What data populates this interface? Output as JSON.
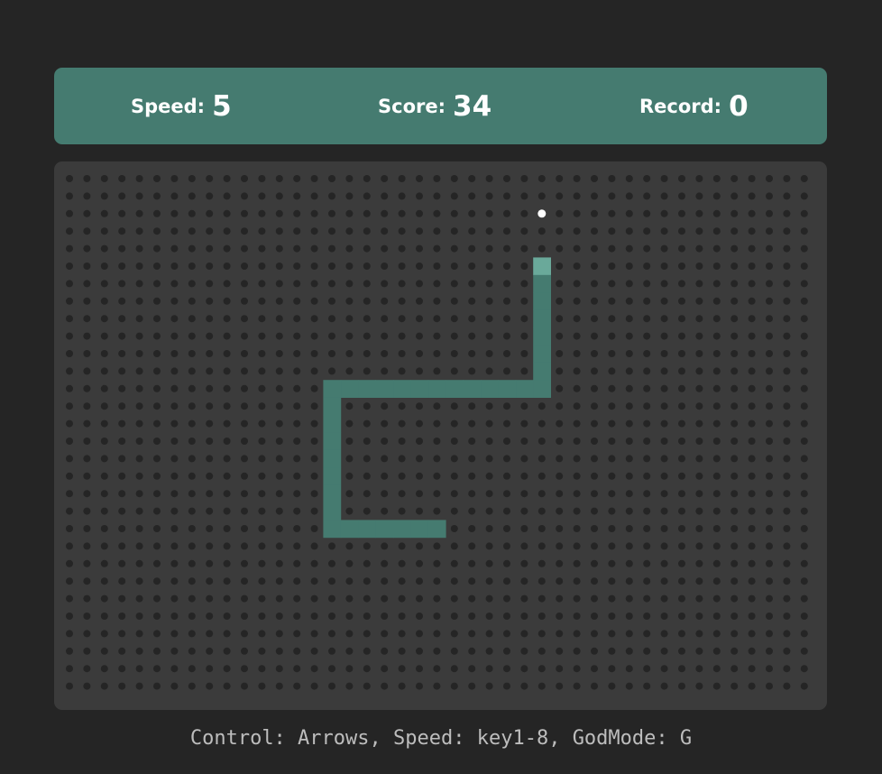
{
  "scoreboard": {
    "speed_label": "Speed:",
    "speed_value": "5",
    "score_label": "Score:",
    "score_value": "34",
    "record_label": "Record:",
    "record_value": "0"
  },
  "board": {
    "columns": 43,
    "rows": 30,
    "snake": [
      [
        27,
        5
      ],
      [
        27,
        6
      ],
      [
        27,
        7
      ],
      [
        27,
        8
      ],
      [
        27,
        9
      ],
      [
        27,
        10
      ],
      [
        27,
        11
      ],
      [
        27,
        12
      ],
      [
        26,
        12
      ],
      [
        25,
        12
      ],
      [
        24,
        12
      ],
      [
        23,
        12
      ],
      [
        22,
        12
      ],
      [
        21,
        12
      ],
      [
        20,
        12
      ],
      [
        19,
        12
      ],
      [
        18,
        12
      ],
      [
        17,
        12
      ],
      [
        16,
        12
      ],
      [
        15,
        12
      ],
      [
        15,
        13
      ],
      [
        15,
        14
      ],
      [
        15,
        15
      ],
      [
        15,
        16
      ],
      [
        15,
        17
      ],
      [
        15,
        18
      ],
      [
        15,
        19
      ],
      [
        15,
        20
      ],
      [
        16,
        20
      ],
      [
        17,
        20
      ],
      [
        18,
        20
      ],
      [
        19,
        20
      ],
      [
        20,
        20
      ],
      [
        21,
        20
      ]
    ],
    "food": [
      27,
      2
    ],
    "colors": {
      "background": "#3b3b3b",
      "dot": "#252525",
      "snake_body": "#457b70",
      "snake_head": "#6aa99a",
      "food": "#ffffff"
    }
  },
  "footer": {
    "controls_text": "Control: Arrows, Speed: key1-8, GodMode: G"
  }
}
